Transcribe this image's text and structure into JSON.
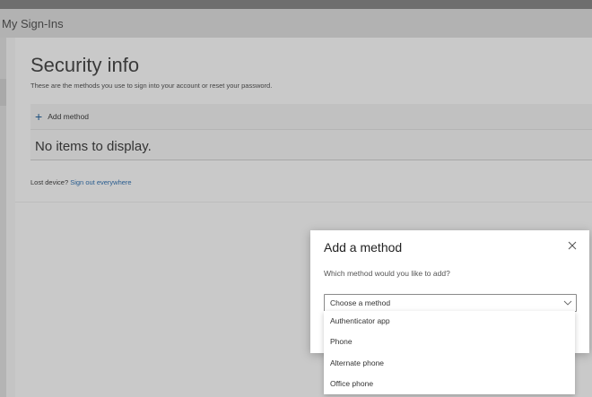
{
  "header": {
    "title": "My Sign-Ins"
  },
  "page": {
    "title": "Security info",
    "subtitle": "These are the methods you use to sign into your account or reset your password."
  },
  "methods_card": {
    "add_method_label": "Add method",
    "empty_text": "No items to display."
  },
  "lost_device": {
    "label": "Lost device?",
    "link": "Sign out everywhere"
  },
  "dialog": {
    "title": "Add a method",
    "question": "Which method would you like to add?",
    "select": {
      "selected": "Choose a method",
      "options": [
        "Authenticator app",
        "Phone",
        "Alternate phone",
        "Office phone"
      ]
    }
  },
  "icons": {
    "plus": "plus-icon",
    "close": "close-icon",
    "chevron": "chevron-down-icon"
  },
  "colors": {
    "overlay_bg": "#c4c4c4",
    "accent": "#1e4f7e",
    "link": "#2a5d8f",
    "dialog_bg": "#ffffff"
  }
}
